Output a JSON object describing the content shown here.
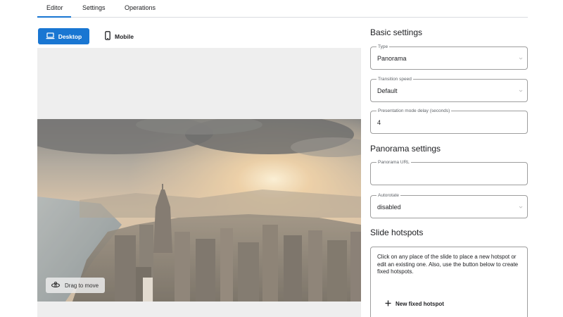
{
  "tabs": [
    {
      "label": "Editor",
      "active": true
    },
    {
      "label": "Settings",
      "active": false
    },
    {
      "label": "Operations",
      "active": false
    }
  ],
  "device_toggle": {
    "desktop_label": "Desktop",
    "mobile_label": "Mobile",
    "selected": "Desktop"
  },
  "preview": {
    "drag_hint": "Drag to move"
  },
  "basic_settings": {
    "title": "Basic settings",
    "type": {
      "label": "Type",
      "value": "Panorama"
    },
    "transition_speed": {
      "label": "Transition speed",
      "value": "Default"
    },
    "presentation_delay": {
      "label": "Presentation mode delay (seconds)",
      "value": "4"
    }
  },
  "panorama_settings": {
    "title": "Panorama settings",
    "panorama_url": {
      "label": "Panorama URL",
      "value": ""
    },
    "autorotate": {
      "label": "Autorotate",
      "value": "disabled"
    }
  },
  "slide_hotspots": {
    "title": "Slide hotspots",
    "description": "Click on any place of the slide to place a new hotspot or edit an existing one. Also, use the button below to create fixed hotspots.",
    "new_fixed_hotspot_label": "New fixed hotspot"
  },
  "colors": {
    "accent": "#1976d2",
    "border": "#9e9e9e",
    "preview_bg": "#eeeeee"
  },
  "icons": {
    "desktop": "laptop-icon",
    "mobile": "smartphone-icon",
    "drag": "drag-360-icon",
    "add": "plus-icon",
    "dropdown": "chevron-down-icon"
  }
}
